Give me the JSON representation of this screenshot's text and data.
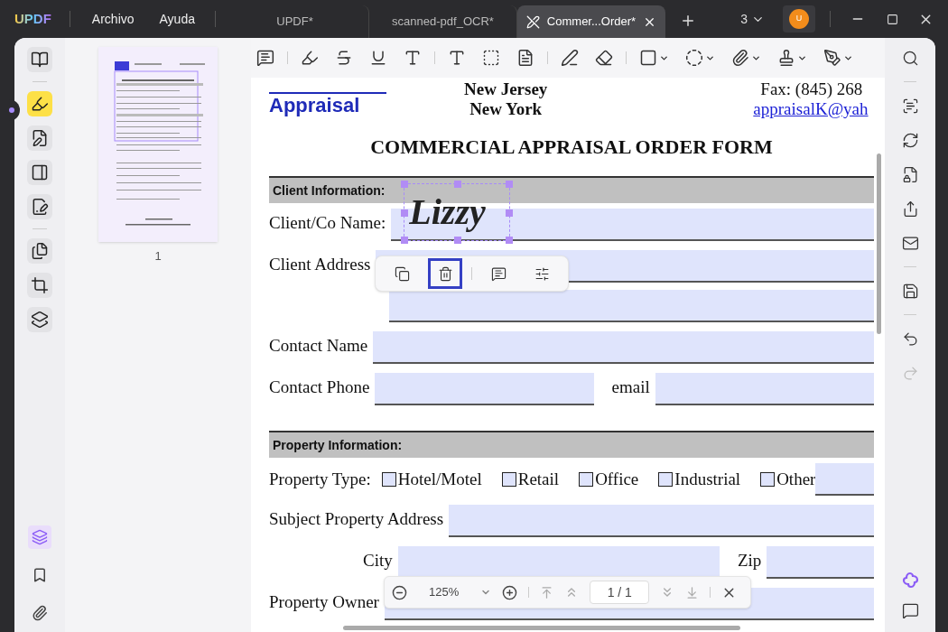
{
  "app": {
    "logo": "UPDF",
    "menus": [
      "Archivo",
      "Ayuda"
    ]
  },
  "tabs": [
    {
      "label": "UPDF*",
      "selected": false
    },
    {
      "label": "scanned-pdf_OCR*",
      "selected": false
    },
    {
      "label": "Commer...Order*",
      "selected": true
    }
  ],
  "window": {
    "tab_count": "3",
    "avatar": "U"
  },
  "left_tools": [
    {
      "selected": false
    },
    {
      "selected": true
    },
    {
      "selected": false
    },
    {
      "selected": false
    },
    {
      "selected": false
    },
    {
      "selected": false
    },
    {
      "selected": false
    },
    {
      "selected": false
    }
  ],
  "left_bottom_tools": [
    {
      "selected": true
    },
    {
      "selected": false
    },
    {
      "selected": false
    }
  ],
  "thumbnail": {
    "page_label": "1"
  },
  "document": {
    "header": {
      "logo": "Appraisal",
      "center": [
        "New Jersey",
        "New York"
      ],
      "fax": "Fax:  (845) 268",
      "email": "appraisalK@yah"
    },
    "title": "COMMERCIAL APPRAISAL ORDER FORM",
    "rows": [
      {
        "kind": "section",
        "label": "Client Information:"
      },
      {
        "kind": "fields",
        "fields": [
          {
            "label": "Client/Co Name:",
            "value": "Lizzy"
          }
        ]
      },
      {
        "kind": "fields",
        "fields": [
          {
            "label": "Client Address"
          }
        ]
      },
      {
        "kind": "blank"
      },
      {
        "kind": "fields",
        "fields": [
          {
            "label": "Contact Name"
          }
        ]
      },
      {
        "kind": "fields",
        "fields": [
          {
            "label": "Contact Phone"
          },
          {
            "label": "email"
          }
        ]
      },
      {
        "kind": "section",
        "label": "Property Information:"
      },
      {
        "kind": "checks",
        "label": "Property Type:",
        "options": [
          {
            "label": "Hotel/Motel",
            "checked": false
          },
          {
            "label": "Retail",
            "checked": false
          },
          {
            "label": "Office",
            "checked": false
          },
          {
            "label": "Industrial",
            "checked": false
          },
          {
            "label": "Other",
            "checked": false
          }
        ]
      },
      {
        "kind": "fields",
        "fields": [
          {
            "label": "Subject Property Address"
          }
        ]
      },
      {
        "kind": "indented",
        "fields": [
          {
            "label": "City"
          },
          {
            "label": "Zip"
          }
        ]
      },
      {
        "kind": "fields",
        "fields": [
          {
            "label": "Property Owner"
          }
        ]
      }
    ]
  },
  "selection_menu": [
    {
      "selected": false
    },
    {
      "selected": true
    },
    {
      "selected": false
    },
    {
      "selected": false
    }
  ],
  "zoom_bar": {
    "zoom": "125%",
    "page": "1 / 1"
  },
  "right_tools": [
    {
      "disabled": false
    },
    {
      "disabled": false
    },
    {
      "disabled": false
    },
    {
      "disabled": false
    },
    {
      "disabled": false
    },
    {
      "disabled": false
    },
    {
      "disabled": false
    },
    {
      "disabled": false
    },
    {
      "disabled": true
    }
  ]
}
